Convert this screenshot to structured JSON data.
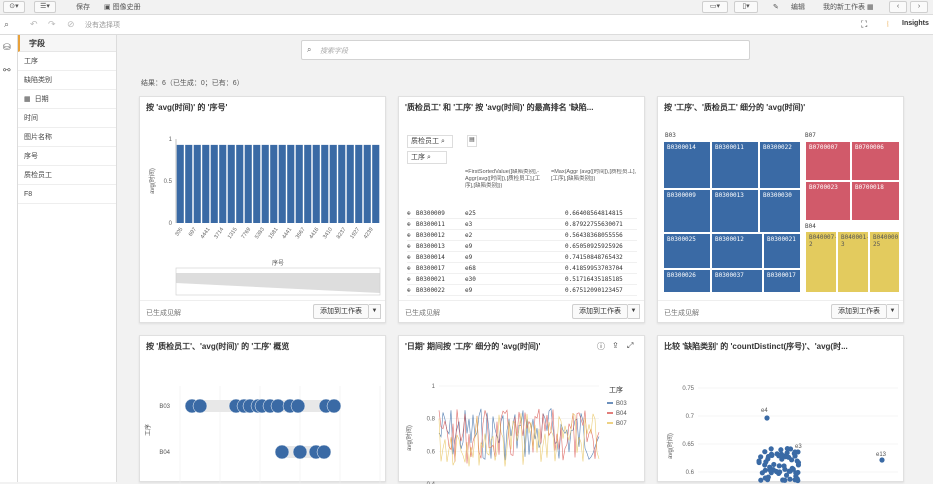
{
  "toolbar": {
    "save_label": "保存",
    "image_label": "图像史册",
    "edit_label": "编辑",
    "my_sheets_label": "我的新工作表",
    "insights_label": "Insights"
  },
  "selections": {
    "empty_text": "没有选择项"
  },
  "fields_panel": {
    "header": "字段",
    "items": [
      "工序",
      "缺陷类别",
      "日期",
      "时间",
      "图片名称",
      "序号",
      "质检员工",
      "F8"
    ]
  },
  "search": {
    "placeholder": "搜索字段"
  },
  "results_text": "结果：6（已生成：0；已有：6）",
  "cards": [
    {
      "title": "按 'avg(时间)' 的 '序号'",
      "footer": "已生成见解",
      "add_label": "添加到工作表",
      "chart_data": {
        "type": "bar",
        "title": "按 'avg(时间)' 的 '序号'",
        "xlabel": "序号",
        "ylabel": "avg(时间)",
        "ylim": [
          0,
          1
        ],
        "ytick_labels": [
          "0",
          "0.5",
          "1"
        ],
        "categories": [
          "305",
          "697",
          "4441",
          "3714",
          "1315",
          "7769",
          "5383",
          "1581",
          "4441",
          "3567",
          "4416",
          "3410",
          "8237",
          "1927",
          "4239"
        ],
        "values": [
          0.93,
          0.93,
          0.93,
          0.93,
          0.93,
          0.93,
          0.93,
          0.93,
          0.93,
          0.93,
          0.93,
          0.93,
          0.93,
          0.93,
          0.93,
          0.93,
          0.93,
          0.93,
          0.93,
          0.93,
          0.93,
          0.93,
          0.93,
          0.93
        ],
        "color": "#3a6aa5"
      }
    },
    {
      "title": "'质检员工' 和 '工序' 按 'avg(时间)' 的最高排名 '缺陷...",
      "footer": "已生成见解",
      "add_label": "添加到工作表",
      "filter_chips": [
        "质检员工",
        "工序"
      ],
      "columns": [
        "=FirstSortedValue([缺陷类别],-Aggr(avg([时间]),[质检员工],[工序],[缺陷类别]))",
        "=Max(Aggr (avg([时间]),[质检员工],[工序],[缺陷类别]))"
      ],
      "rows": [
        [
          "B0300009",
          "e25",
          "0.66408564814815"
        ],
        [
          "B0300011",
          "e3",
          "0.87922755630071"
        ],
        [
          "B0300012",
          "e2",
          "0.56438368055556"
        ],
        [
          "B0300013",
          "e9",
          "0.65050925925926"
        ],
        [
          "B0300014",
          "e9",
          "0.74150848765432"
        ],
        [
          "B0300017",
          "e68",
          "0.41859953703704"
        ],
        [
          "B0300021",
          "e30",
          "0.51716435185185"
        ],
        [
          "B0300022",
          "e9",
          "0.67512090123457"
        ]
      ]
    },
    {
      "title": "按 '工序'、'质检员工' 细分的 'avg(时间)'",
      "footer": "已生成见解",
      "add_label": "添加到工作表",
      "groups": {
        "B03": [
          "B0300014",
          "B0300011",
          "B0300022",
          "B0300009",
          "B0300013",
          "B0300030",
          "B0300025",
          "B0300012",
          "B0300021",
          "B0300026",
          "B0300037",
          "B0300017"
        ],
        "B07": [
          "B0700007",
          "B0700006",
          "B0700023",
          "B0700018"
        ],
        "B04": [
          "B040007-2",
          "B040001-3",
          "B040000-25"
        ]
      },
      "group_labels": [
        "B03",
        "B07",
        "B04"
      ]
    },
    {
      "title": "按 '质检员工'、'avg(时间)' 的 '工序' 概览",
      "ylabel": "工序",
      "categories": [
        "B03",
        "B04",
        "B07"
      ]
    },
    {
      "title": "'日期' 期间按 '工序' 细分的 'avg(时间)'",
      "legend_title": "工序",
      "legend": [
        "B03",
        "B04",
        "B07"
      ],
      "ylabel": "avg(时间)",
      "yticks": [
        "1",
        "0.8",
        "0.6",
        "0.4"
      ],
      "colors": [
        "#3a6aa5",
        "#d9534f",
        "#e8c35a"
      ]
    },
    {
      "title": "比较 '缺陷类别' 的 'countDistinct(序号)'、'avg(时...",
      "ylabel": "avg(时间)",
      "yticks": [
        "0.75",
        "0.7",
        "0.65",
        "0.6",
        "0.55"
      ],
      "point_labels": [
        "e4",
        "e3",
        "e13"
      ]
    }
  ]
}
